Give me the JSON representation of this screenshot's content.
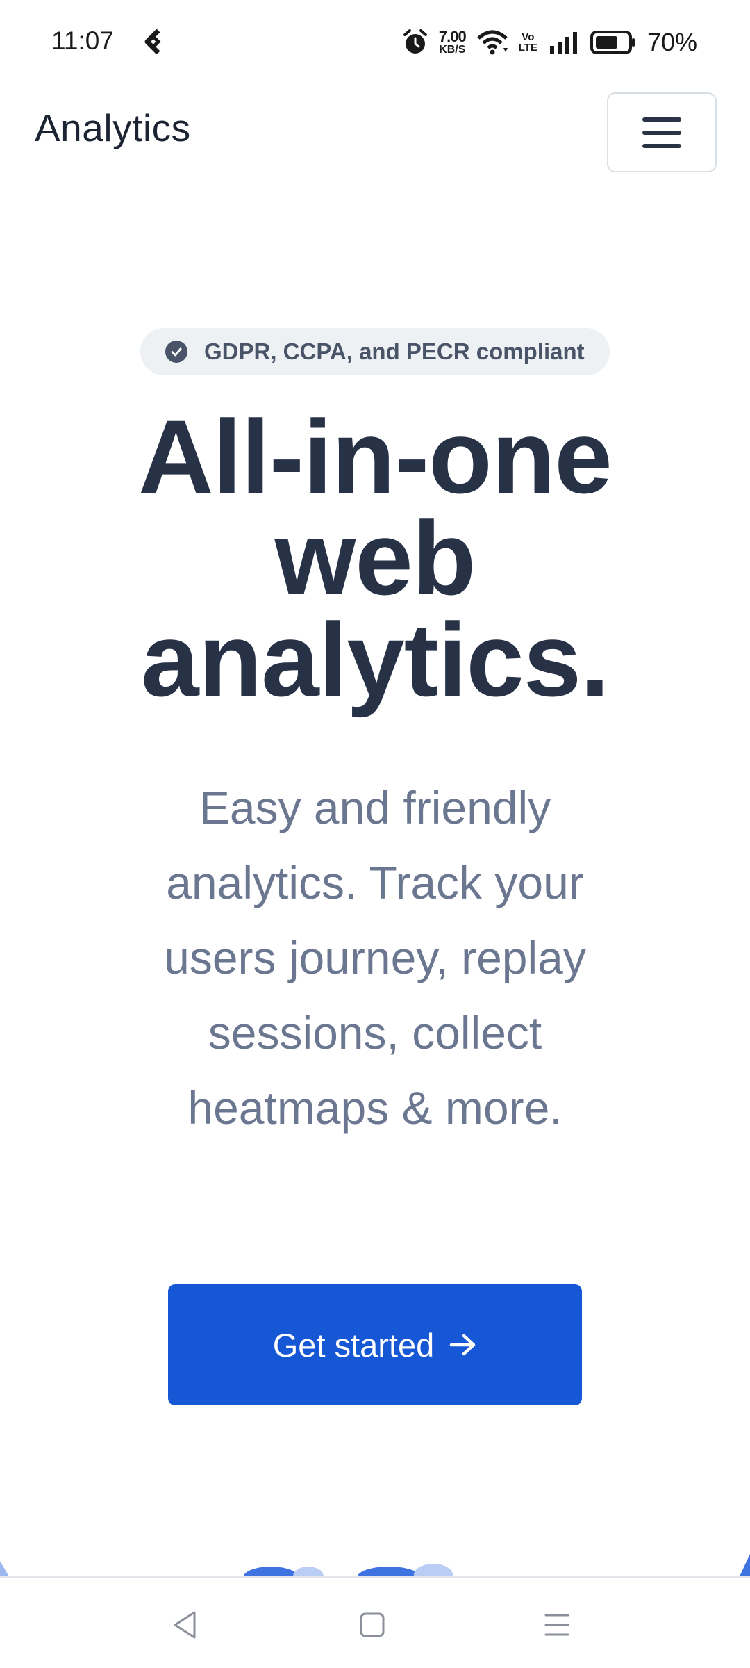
{
  "status_bar": {
    "time": "11:07",
    "net_speed_value": "7.00",
    "net_speed_unit": "KB/S",
    "volte_top": "Vo",
    "volte_bottom": "LTE",
    "battery_percent": "70%",
    "battery_level": 0.7
  },
  "nav": {
    "brand": "Analytics",
    "menu_icon": "hamburger-icon"
  },
  "badge": {
    "icon": "check-circle-icon",
    "text": "GDPR, CCPA, and PECR compliant"
  },
  "hero": {
    "title_line1": "All-in-one",
    "title_line2": "web",
    "title_line3": "analytics.",
    "subtitle": "Easy and friendly analytics. Track your users journey, replay sessions, collect heatmaps & more."
  },
  "cta": {
    "label": "Get started",
    "icon": "arrow-right-icon"
  },
  "colors": {
    "accent": "#1557d4",
    "heading": "#283247",
    "muted": "#6b7790",
    "badge_bg": "#eef1f4"
  },
  "system_nav": {
    "back_icon": "back-triangle-icon",
    "home_icon": "home-square-icon",
    "recents_icon": "menu-lines-icon"
  }
}
